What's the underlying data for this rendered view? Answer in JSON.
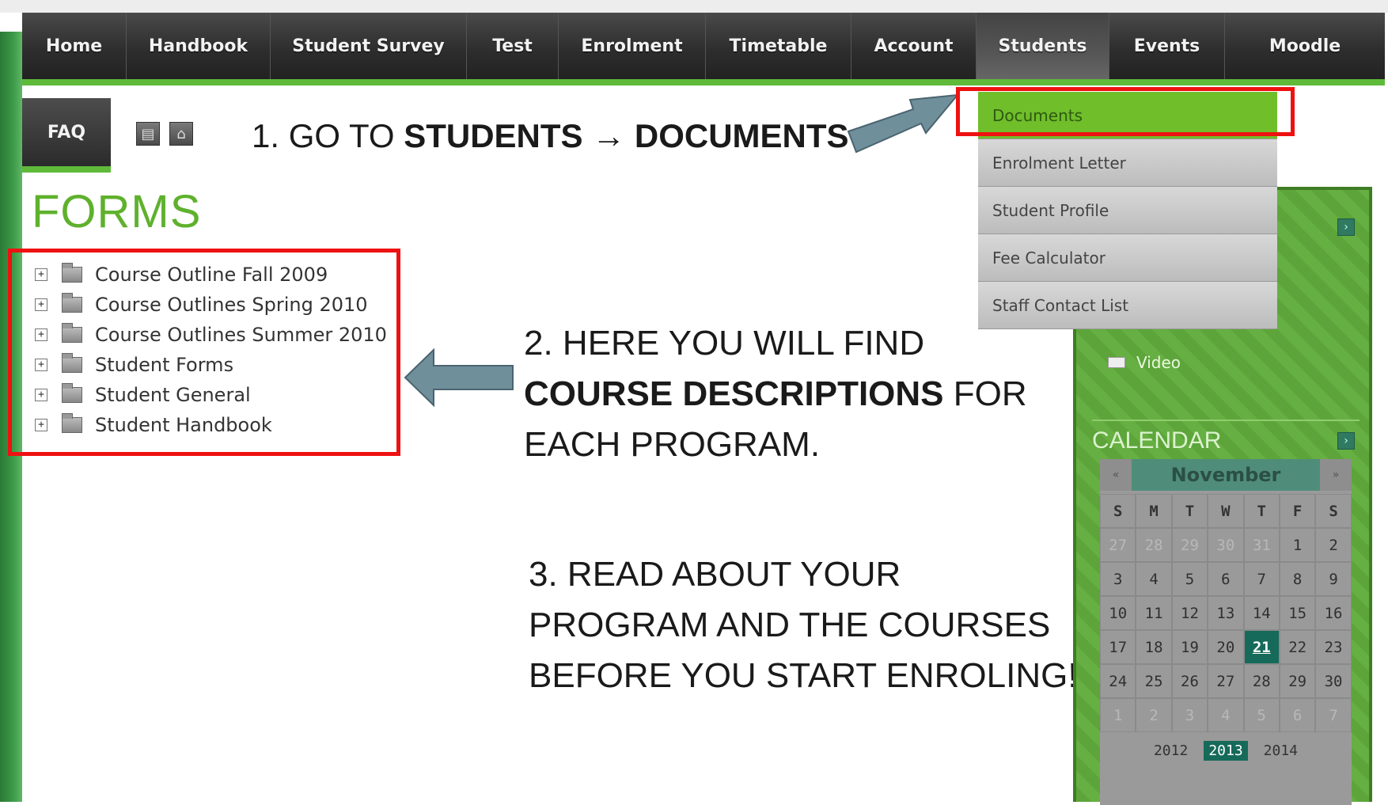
{
  "nav": {
    "items": [
      {
        "label": "Home"
      },
      {
        "label": "Handbook"
      },
      {
        "label": "Student Survey"
      },
      {
        "label": "Test"
      },
      {
        "label": "Enrolment"
      },
      {
        "label": "Timetable"
      },
      {
        "label": "Account"
      },
      {
        "label": "Students"
      },
      {
        "label": "Events"
      },
      {
        "label": "Moodle"
      }
    ],
    "active": "Students"
  },
  "faq_tab": "FAQ",
  "forms_heading": "FORMS",
  "forms_tree": [
    "Course Outline Fall 2009",
    "Course Outlines Spring 2010",
    "Course Outlines Summer 2010",
    "Student Forms",
    "Student General",
    "Student Handbook"
  ],
  "students_menu": {
    "items": [
      "Documents",
      "Enrolment Letter",
      "Student Profile",
      "Fee Calculator",
      "Staff Contact List"
    ],
    "selected": "Documents"
  },
  "sidebar": {
    "video_label": "Video",
    "calendar_title": "CALENDAR",
    "calendar": {
      "prev": "«",
      "next": "»",
      "month": "November",
      "weekdays": [
        "S",
        "M",
        "T",
        "W",
        "T",
        "F",
        "S"
      ],
      "weeks": [
        [
          "27",
          "28",
          "29",
          "30",
          "31",
          "1",
          "2"
        ],
        [
          "3",
          "4",
          "5",
          "6",
          "7",
          "8",
          "9"
        ],
        [
          "10",
          "11",
          "12",
          "13",
          "14",
          "15",
          "16"
        ],
        [
          "17",
          "18",
          "19",
          "20",
          "21",
          "22",
          "23"
        ],
        [
          "24",
          "25",
          "26",
          "27",
          "28",
          "29",
          "30"
        ],
        [
          "1",
          "2",
          "3",
          "4",
          "5",
          "6",
          "7"
        ]
      ],
      "today": "21",
      "years": [
        "2012",
        "2013",
        "2014"
      ],
      "selected_year": "2013"
    }
  },
  "instructions": {
    "step1_prefix": "1. GO TO ",
    "step1_bold": "STUDENTS → DOCUMENTS",
    "step2_line1": "2. HERE YOU WILL FIND",
    "step2_bold": "COURSE DESCRIPTIONS",
    "step2_after": " FOR",
    "step2_line3": "EACH PROGRAM.",
    "step3_line1": "3. READ ABOUT YOUR",
    "step3_line2": "PROGRAM AND THE COURSES",
    "step3_line3": "BEFORE YOU START ENROLING!"
  },
  "colors": {
    "highlight": "#ee1111",
    "arrow": "#6f8f9a",
    "accent_green": "#5fb12d"
  }
}
